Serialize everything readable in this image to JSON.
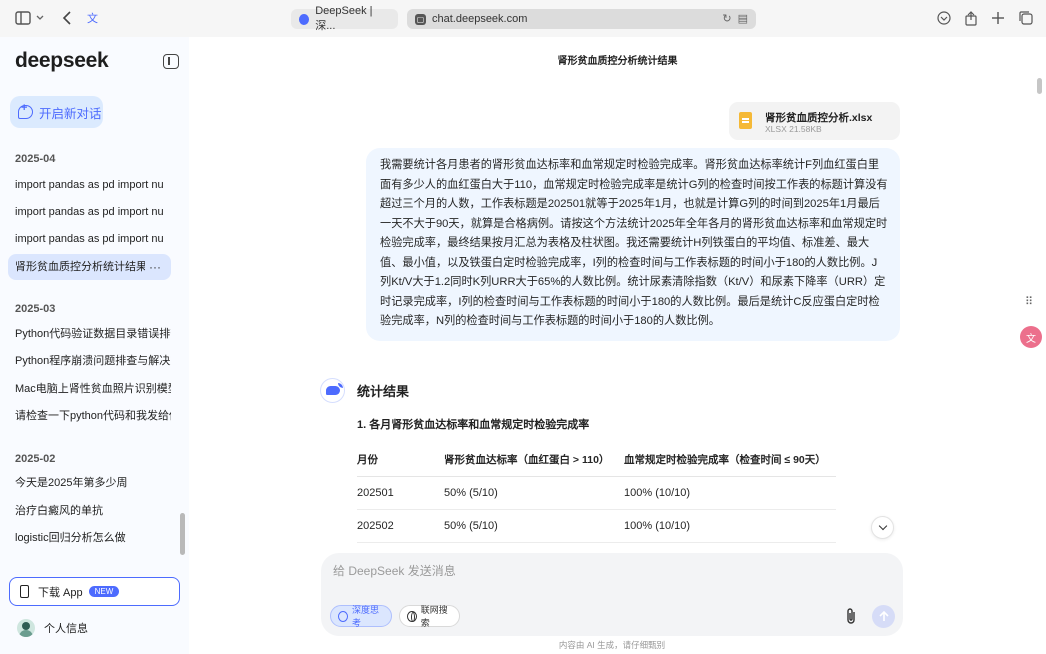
{
  "browser": {
    "tabs": [
      {
        "label": "DeepSeek | 深...",
        "active": false
      },
      {
        "label": "chat.deepseek.com",
        "active": true
      }
    ]
  },
  "sidebar": {
    "logo": "deepseek",
    "new_chat": "开启新对话",
    "groups": [
      {
        "title": "2025-04",
        "items": [
          {
            "label": "import pandas as pd import nu",
            "selected": false
          },
          {
            "label": "import pandas as pd import nu",
            "selected": false
          },
          {
            "label": "import pandas as pd import nu",
            "selected": false
          },
          {
            "label": "肾形贫血质控分析统计结果",
            "selected": true,
            "more": "···"
          }
        ]
      },
      {
        "title": "2025-03",
        "items": [
          {
            "label": "Python代码验证数据目录错误排查"
          },
          {
            "label": "Python程序崩溃问题排查与解决方"
          },
          {
            "label": "Mac电脑上肾性贫血照片识别模型"
          },
          {
            "label": "请检查一下python代码和我发给你"
          }
        ]
      },
      {
        "title": "2025-02",
        "items": [
          {
            "label": "今天是2025年第多少周"
          },
          {
            "label": "治疗白癜风的单抗"
          },
          {
            "label": "logistic回归分析怎么做"
          }
        ]
      }
    ],
    "download": {
      "label": "下载 App",
      "badge": "NEW"
    },
    "profile": "个人信息"
  },
  "chat": {
    "title": "肾形贫血质控分析统计结果",
    "file": {
      "name": "肾形贫血质控分析.xlsx",
      "meta": "XLSX 21.58KB"
    },
    "user_message": "我需要统计各月患者的肾形贫血达标率和血常规定时检验完成率。肾形贫血达标率统计F列血红蛋白里面有多少人的血红蛋白大于110，血常规定时检验完成率是统计G列的检查时间按工作表的标题计算没有超过三个月的人数，工作表标题是202501就等于2025年1月，也就是计算G列的时间到2025年1月最后一天不大于90天，就算是合格病例。请按这个方法统计2025年全年各月的肾形贫血达标率和血常规定时检验完成率，最终结果按月汇总为表格及柱状图。我还需要统计H列铁蛋白的平均值、标准差、最大值、最小值，以及铁蛋白定时检验完成率，I列的检查时间与工作表标题的时间小于180的人数比例。J列Kt/V大于1.2同时K列URR大于65%的人数比例。统计尿素清除指数（Kt/V）和尿素下降率（URR）定时记录完成率，I列的检查时间与工作表标题的时间小于180的人数比例。最后是统计C反应蛋白定时检验完成率，N列的检查时间与工作表标题的时间小于180的人数比例。",
    "response": {
      "heading": "统计结果",
      "subheading": "1. 各月肾形贫血达标率和血常规定时检验完成率",
      "table": {
        "headers": [
          "月份",
          "肾形贫血达标率（血红蛋白 > 110）",
          "血常规定时检验完成率（检查时间 ≤ 90天）"
        ],
        "rows": [
          [
            "202501",
            "50% (5/10)",
            "100% (10/10)"
          ],
          [
            "202502",
            "50% (5/10)",
            "100% (10/10)"
          ]
        ]
      }
    },
    "composer": {
      "placeholder": "给 DeepSeek 发送消息",
      "deep_think": "深度思考",
      "web_search": "联网搜索"
    },
    "footnote": "内容由 AI 生成，请仔细甄别"
  },
  "colors": {
    "accent": "#4d6bfe",
    "user_bubble": "#eff6ff",
    "sidebar_bg": "#f9fbff"
  }
}
